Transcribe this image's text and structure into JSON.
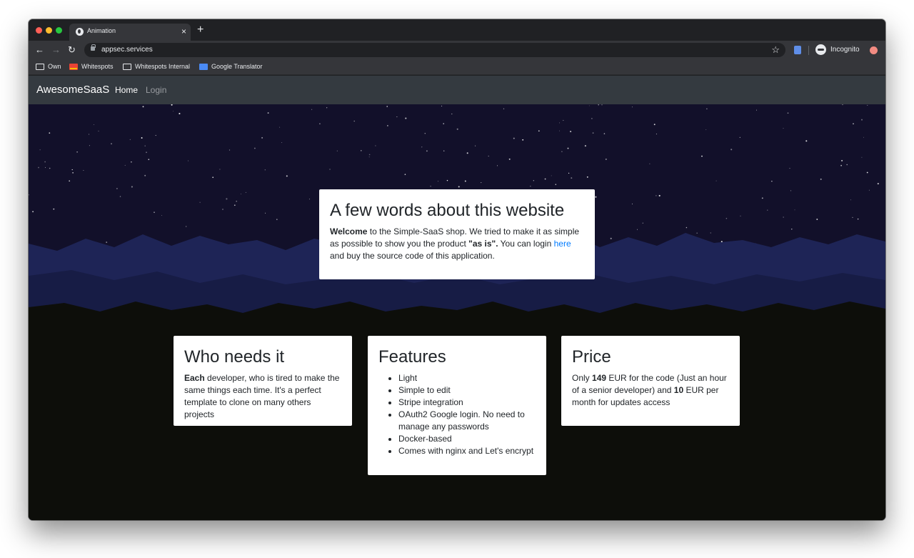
{
  "browser": {
    "tab_title": "Animation",
    "url": "appsec.services",
    "profile_label": "Incognito",
    "bookmarks": [
      "Own",
      "Whitespots",
      "Whitespots Internal",
      "Google Translator"
    ]
  },
  "navbar": {
    "brand": "AwesomeSaaS",
    "links": [
      "Home",
      "Login"
    ]
  },
  "about": {
    "title": "A few words about this website",
    "bold_lead": "Welcome",
    "text1": " to the Simple-SaaS shop. We tried to make it as simple as possible to show you the product ",
    "bold_quote": "\"as is\".",
    "text2": " You can login ",
    "link": "here",
    "text3": " and buy the source code of this application."
  },
  "who": {
    "title": "Who needs it",
    "bold_lead": "Each",
    "text": " developer, who is tired to make the same things each time. It's a perfect template to clone on many others projects"
  },
  "features": {
    "title": "Features",
    "items": [
      "Light",
      "Simple to edit",
      "Stripe integration",
      "OAuth2 Google login. No need to manage any passwords",
      "Docker-based",
      "Comes with nginx and Let's encrypt"
    ]
  },
  "price": {
    "title": "Price",
    "text1": "Only ",
    "amount_code": "149",
    "text2": " EUR for the code (Just an hour of a senior developer) and ",
    "amount_updates": "10",
    "text3": " EUR per month for updates access"
  },
  "colors": {
    "sky": "#12102a",
    "mountains": "#1e2456",
    "ground": "#0d0e0a",
    "navbar": "#343a40",
    "link": "#007bff"
  }
}
